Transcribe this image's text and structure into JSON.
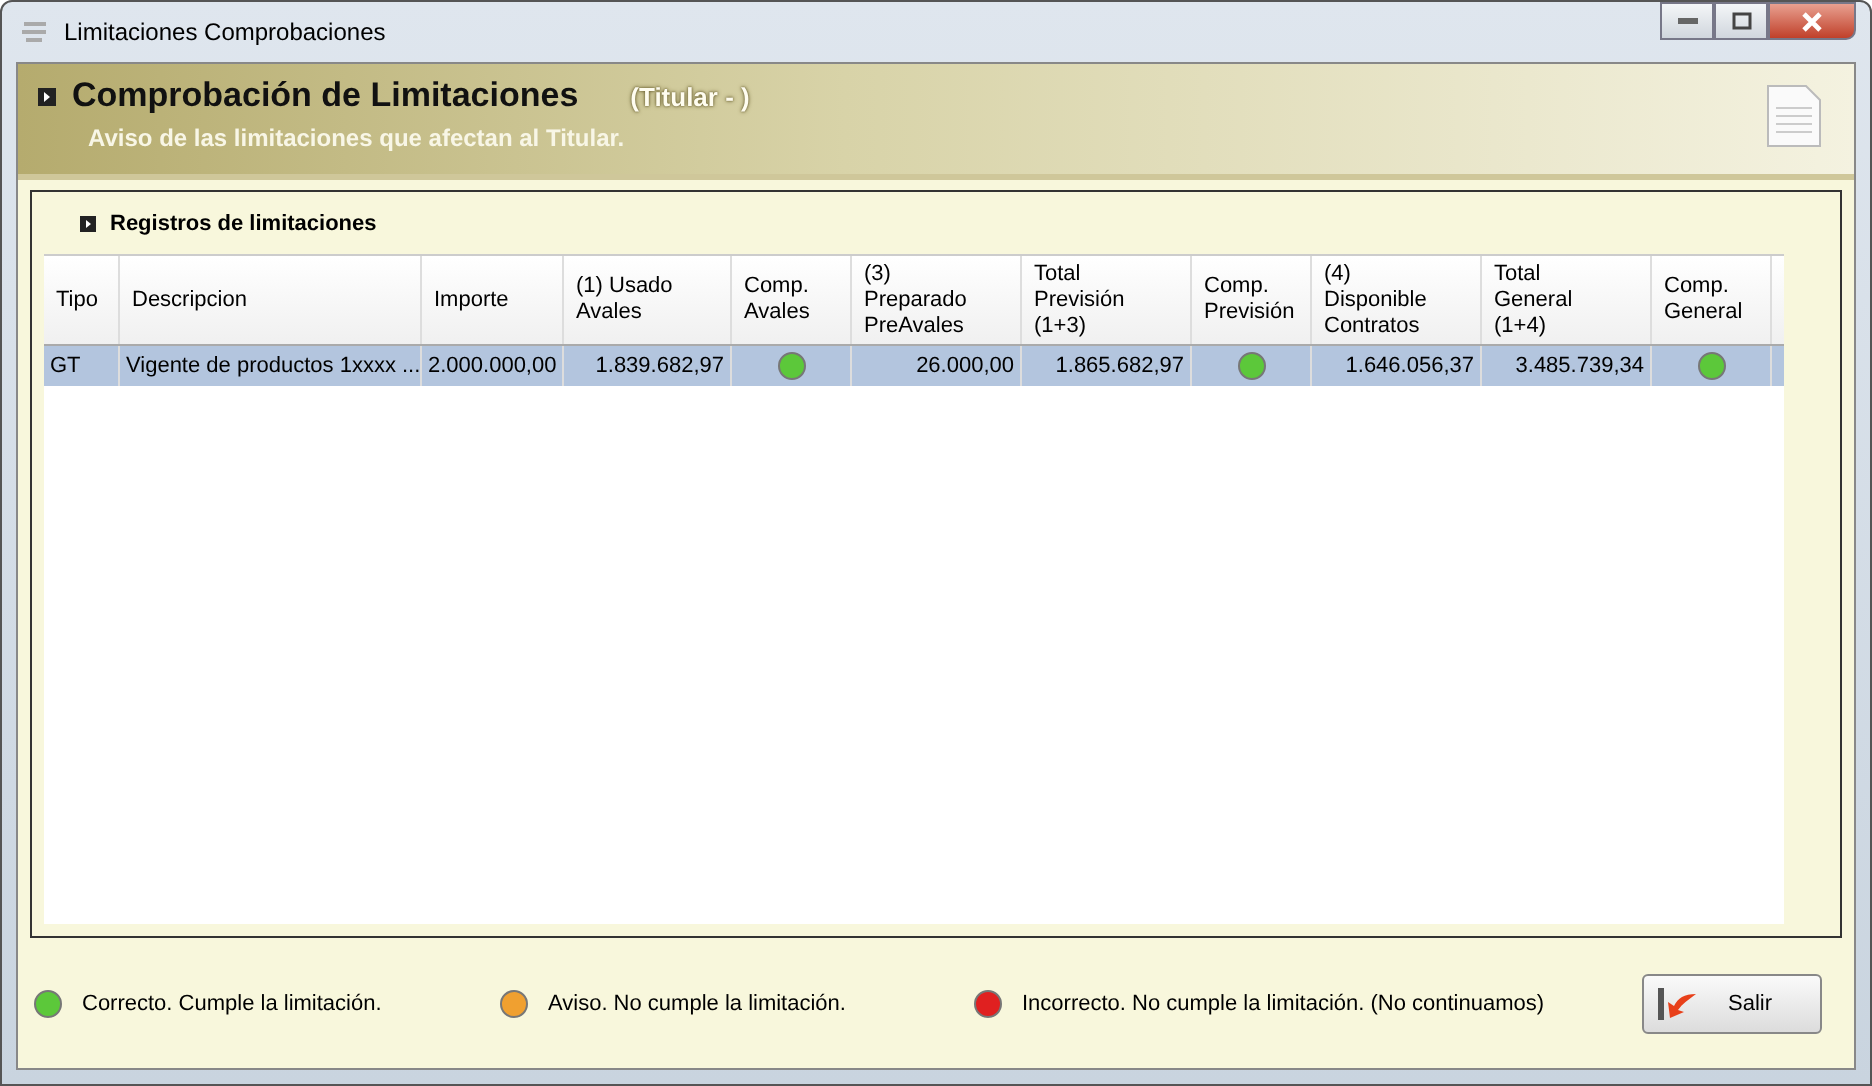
{
  "window": {
    "title": "Limitaciones Comprobaciones"
  },
  "header": {
    "title": "Comprobación de Limitaciones",
    "subject": "(Titular  - )",
    "subtitle": "Aviso de las limitaciones que afectan al Titular."
  },
  "panel": {
    "title": "Registros de limitaciones"
  },
  "table": {
    "columns": [
      {
        "label": "Tipo",
        "kind": "text"
      },
      {
        "label": "Descripcion",
        "kind": "text"
      },
      {
        "label": "Importe",
        "kind": "text"
      },
      {
        "label": "(1) Usado\nAvales",
        "kind": "number"
      },
      {
        "label": "Comp.\nAvales",
        "kind": "status"
      },
      {
        "label": "(3)\nPreparado\nPreAvales",
        "kind": "number"
      },
      {
        "label": "Total\nPrevisión\n(1+3)",
        "kind": "number"
      },
      {
        "label": "Comp.\nPrevisión",
        "kind": "status"
      },
      {
        "label": "(4)\nDisponible\nContratos",
        "kind": "number"
      },
      {
        "label": "Total\nGeneral\n(1+4)",
        "kind": "number"
      },
      {
        "label": "Comp.\nGeneral",
        "kind": "status"
      }
    ],
    "rows": [
      {
        "selected": true,
        "cells": [
          "GT",
          "Vigente de productos 1xxxx ...",
          "2.000.000,00",
          "1.839.682,97",
          {
            "color": "#5cc83a"
          },
          "26.000,00",
          "1.865.682,97",
          {
            "color": "#5cc83a"
          },
          "1.646.056,37",
          "3.485.739,34",
          {
            "color": "#5cc83a"
          }
        ]
      }
    ]
  },
  "legend": [
    {
      "color": "#5cc83a",
      "label": "Correcto. Cumple la limitación."
    },
    {
      "color": "#f0a030",
      "label": "Aviso. No cumple la limitación."
    },
    {
      "color": "#e02020",
      "label": "Incorrecto. No cumple la limitación. (No continuamos)"
    }
  ],
  "buttons": [
    {
      "label": "Salir"
    }
  ]
}
